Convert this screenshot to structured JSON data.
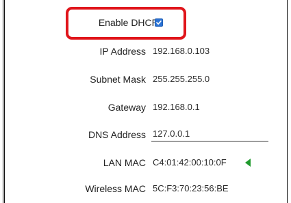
{
  "dhcp": {
    "label": "Enable DHCP",
    "checked": true
  },
  "fields": {
    "ip_address": {
      "label": "IP Address",
      "value": "192.168.0.103"
    },
    "subnet_mask": {
      "label": "Subnet Mask",
      "value": "255.255.255.0"
    },
    "gateway": {
      "label": "Gateway",
      "value": "192.168.0.1"
    },
    "dns_address": {
      "label": "DNS Address",
      "value": "127.0.0.1"
    },
    "lan_mac": {
      "label": "LAN MAC",
      "value": "C4:01:42:00:10:0F"
    },
    "wireless_mac": {
      "label": "Wireless MAC",
      "value": "5C:F3:70:23:56:BE"
    }
  },
  "icons": {
    "lan_indicator": "left-triangle-icon",
    "checkbox": "checkmark-icon"
  },
  "colors": {
    "highlight": "#e0151b",
    "checkbox": "#2a72d4",
    "indicator": "#1f9a2d"
  }
}
